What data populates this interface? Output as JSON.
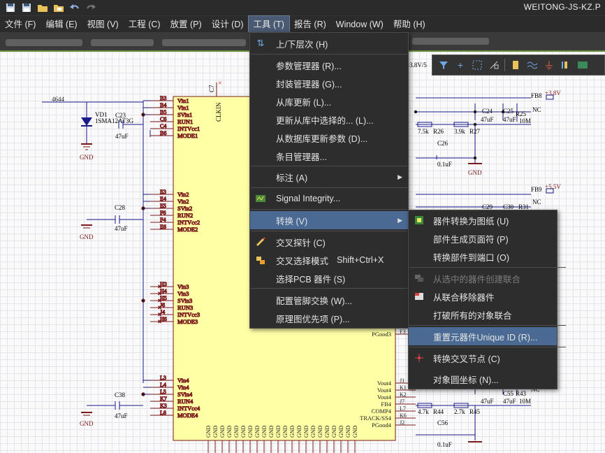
{
  "window": {
    "title": "WEITONG-JS-KZ.P"
  },
  "menubar": {
    "items": [
      "文件 (F)",
      "编辑 (E)",
      "视图 (V)",
      "工程 (C)",
      "放置 (P)",
      "设计 (D)",
      "工具 (T)",
      "报告 (R)",
      "Window (W)",
      "帮助 (H)"
    ]
  },
  "tools_menu": {
    "items": [
      {
        "label": "上/下层次 (H)",
        "icon": "up-down-arrows-icon"
      },
      {
        "label": "参数管理器 (R)..."
      },
      {
        "label": "封装管理器 (G)..."
      },
      {
        "label": "从库更新 (L)..."
      },
      {
        "label": "更新从库中选择的... (L)..."
      },
      {
        "label": "从数据库更新参数 (D)..."
      },
      {
        "label": "条目管理器..."
      },
      {
        "label": "标注 (A)",
        "submenu": true
      },
      {
        "label": "Signal Integrity...",
        "icon": "signal-integrity-icon"
      },
      {
        "label": "转换 (V)",
        "submenu": true
      },
      {
        "label": "交叉探针 (C)",
        "icon": "cross-probe-icon"
      },
      {
        "label": "交叉选择模式",
        "shortcut": "Shift+Ctrl+X",
        "icon": "cross-select-icon"
      },
      {
        "label": "选择PCB 器件 (S)"
      },
      {
        "label": "配置管脚交换 (W)..."
      },
      {
        "label": "原理图优先项 (P)..."
      }
    ]
  },
  "convert_menu": {
    "items": [
      {
        "label": "器件转换为图纸 (U)",
        "icon": "part-to-sheet-icon"
      },
      {
        "label": "部件生成页面符 (P)"
      },
      {
        "label": "转换部件到端口 (O)"
      },
      {
        "label": "从选中的器件创建联合",
        "disabled": true,
        "icon": "union-icon"
      },
      {
        "label": "从联合移除器件",
        "icon": "remove-union-icon"
      },
      {
        "label": "打破所有的对象联合"
      },
      {
        "label": "重置元器件Unique ID (R)..."
      },
      {
        "label": "转换交叉节点 (C)",
        "icon": "junction-icon"
      },
      {
        "label": "对象圆坐标 (N)..."
      }
    ]
  },
  "schematic": {
    "net_label": "4644",
    "ic_left_pins": [
      [
        "B3",
        "Vin1"
      ],
      [
        "B4",
        "Vin1"
      ],
      [
        "B5",
        "SVin1"
      ],
      [
        "C6",
        "RUN1"
      ],
      [
        "C4",
        "INTVcc1"
      ],
      [
        "B6",
        "MODE1"
      ],
      [
        "E3",
        "Vin2"
      ],
      [
        "E4",
        "Vin2"
      ],
      [
        "E5",
        "SVin2"
      ],
      [
        "F6",
        "RUN2"
      ],
      [
        "F4",
        "INTVcc2"
      ],
      [
        "E6",
        "MODE2"
      ],
      [
        "H3",
        "Vin3"
      ],
      [
        "H4",
        "Vin3"
      ],
      [
        "H5",
        "SVin3"
      ],
      [
        "J6",
        "RUN3"
      ],
      [
        "J4",
        "INTVcc3"
      ],
      [
        "H6",
        "MODE3"
      ],
      [
        "L3",
        "Vin4"
      ],
      [
        "L4",
        "Vin4"
      ],
      [
        "L5",
        "SVin4"
      ],
      [
        "K7",
        "RUN4"
      ],
      [
        "K3",
        "INTVcc4"
      ],
      [
        "L6",
        "MODE4"
      ]
    ],
    "ic_right_pins": [
      [
        "F3",
        "PGood3"
      ],
      [
        "J1",
        "Vout4"
      ],
      [
        "K1",
        "Vout4"
      ],
      [
        "K2",
        "Vout4"
      ],
      [
        "J7",
        "FB4"
      ],
      [
        "L7",
        "COMP4"
      ],
      [
        "K6",
        "TRACK/SS4"
      ],
      [
        "J2",
        "PGood4"
      ]
    ],
    "clkin": "CLKIN",
    "c7": "C7",
    "diode": [
      "VD1",
      "1SMA12AT3G"
    ],
    "caps_left": [
      {
        "ref": "C23",
        "val": "47uF"
      },
      {
        "ref": "C28",
        "val": "47uF"
      },
      {
        "ref": "C38",
        "val": "47uF"
      }
    ],
    "gnd": "GND",
    "right_top": {
      "c24": [
        "C24",
        "47uF"
      ],
      "c25": [
        "C25",
        "47uF"
      ],
      "r25": [
        "R25",
        "10M"
      ],
      "r26": [
        "7.5k",
        "R26"
      ],
      "r27": [
        "3.9k",
        "R27"
      ],
      "c26": [
        "C26",
        "0.1uF"
      ],
      "fb8": "FB8",
      "nc": "NC",
      "v38": "+3.8V",
      "fb9": "FB9",
      "v55": "+5.5V",
      "c29": "C29",
      "c30": "C30",
      "r31": "R31",
      "v38_top": "+3.8V/5"
    },
    "right_bottom": {
      "c55": [
        "C55",
        "47uF"
      ],
      "r43": [
        "R43",
        "10M"
      ],
      "r44": [
        "4.7k",
        "R44"
      ],
      "r45": [
        "2.7k",
        "R45"
      ],
      "c56": [
        "C56",
        "0.1uF"
      ],
      "uf": "47uF",
      "nc": "NC"
    },
    "bottom_pins": "GND"
  },
  "toolbar_icons": [
    "filter-icon",
    "add-icon",
    "select-rect-icon",
    "wire-icon",
    "component-icon",
    "bus-icon",
    "power-icon",
    "port-icon",
    "net-icon"
  ]
}
